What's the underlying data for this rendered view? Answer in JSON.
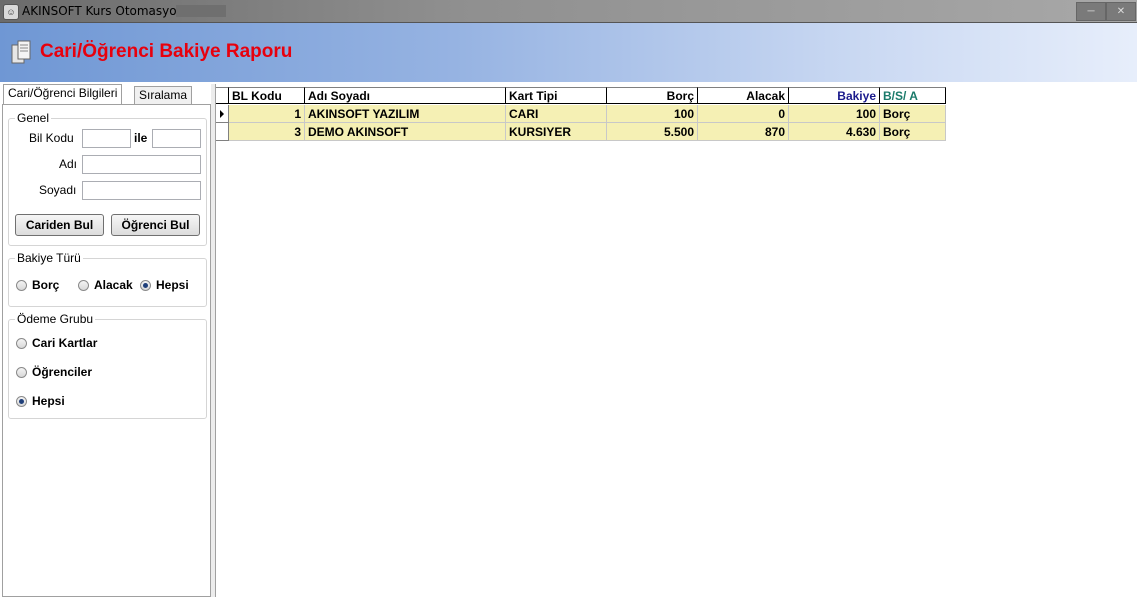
{
  "window": {
    "title": "AKINSOFT Kurs Otomasyonu s"
  },
  "header": {
    "title": "Cari/Öğrenci Bakiye Raporu"
  },
  "tabs": [
    {
      "label": "Cari/Öğrenci Bilgileri",
      "active": true
    },
    {
      "label": "Sıralama",
      "active": false
    }
  ],
  "genel": {
    "legend": "Genel",
    "bil_kodu_label": "Bil Kodu",
    "ile_label": "ile",
    "adi_label": "Adı",
    "soyadi_label": "Soyadı",
    "bil_kodu_from": "",
    "bil_kodu_to": "",
    "adi": "",
    "soyadi": "",
    "cariden_bul": "Cariden Bul",
    "ogrenci_bul": "Öğrenci Bul"
  },
  "bakiye_turu": {
    "legend": "Bakiye Türü",
    "options": [
      "Borç",
      "Alacak",
      "Hepsi"
    ],
    "selected": "Hepsi"
  },
  "odeme_grubu": {
    "legend": "Ödeme Grubu",
    "options": [
      "Cari Kartlar",
      "Öğrenciler",
      "Hepsi"
    ],
    "selected": "Hepsi"
  },
  "grid": {
    "columns": [
      "BL Kodu",
      "Adı Soyadı",
      "Kart Tipi",
      "Borç",
      "Alacak",
      "Bakiye",
      "B/S/ A"
    ],
    "column_colors": {
      "Bakiye": "#1a1a8c",
      "B/S/ A": "#1a7a6a"
    },
    "rows": [
      {
        "bl_kodu": "1",
        "adi_soyadi": "AKINSOFT YAZILIM",
        "kart_tipi": "CARI",
        "borc": "100",
        "alacak": "0",
        "bakiye": "100",
        "bsa": "Borç"
      },
      {
        "bl_kodu": "3",
        "adi_soyadi": "DEMO AKINSOFT",
        "kart_tipi": "KURSIYER",
        "borc": "5.500",
        "alacak": "870",
        "bakiye": "4.630",
        "bsa": "Borç"
      }
    ]
  },
  "colors": {
    "title_red": "#e8000d",
    "row_bg": "#f5f0b4"
  }
}
